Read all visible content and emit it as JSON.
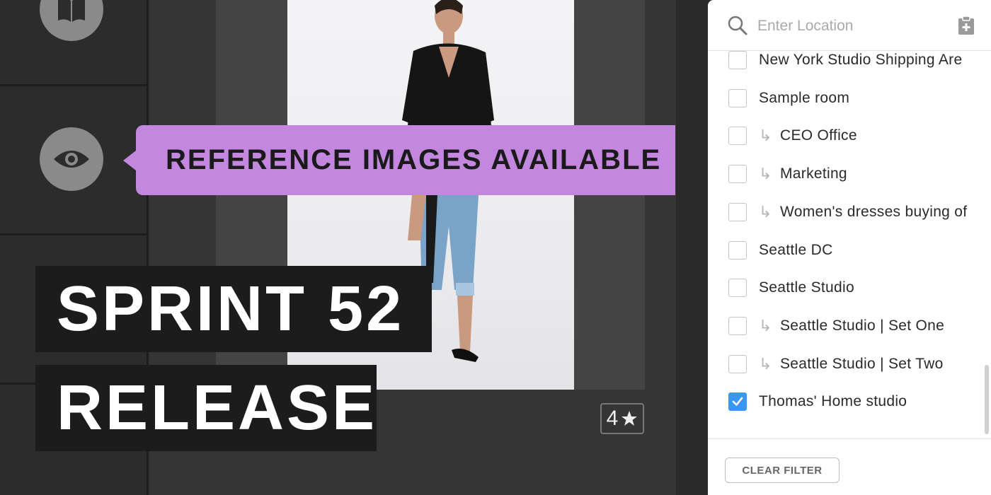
{
  "tooltip": {
    "text": "REFERENCE IMAGES AVAILABLE"
  },
  "title": {
    "line1": "SPRINT 52",
    "line2": "RELEASE"
  },
  "rating": {
    "value": "4"
  },
  "rail": {
    "icons": [
      "book-icon",
      "eye-icon"
    ]
  },
  "search": {
    "placeholder": "Enter Location"
  },
  "locations": [
    {
      "label": "New York Studio Shipping Are",
      "child": false,
      "checked": false
    },
    {
      "label": "Sample room",
      "child": false,
      "checked": false
    },
    {
      "label": "CEO Office",
      "child": true,
      "checked": false
    },
    {
      "label": "Marketing",
      "child": true,
      "checked": false
    },
    {
      "label": "Women's dresses buying of",
      "child": true,
      "checked": false
    },
    {
      "label": "Seattle DC",
      "child": false,
      "checked": false
    },
    {
      "label": "Seattle Studio",
      "child": false,
      "checked": false
    },
    {
      "label": "Seattle Studio | Set One",
      "child": true,
      "checked": false
    },
    {
      "label": "Seattle Studio | Set Two",
      "child": true,
      "checked": false
    },
    {
      "label": "Thomas' Home studio",
      "child": false,
      "checked": true
    }
  ],
  "footer": {
    "clear_label": "CLEAR FILTER"
  },
  "colors": {
    "tooltip": "#c387e0",
    "checkbox_checked": "#3b97f3",
    "title_bg": "#1c1c1c"
  }
}
